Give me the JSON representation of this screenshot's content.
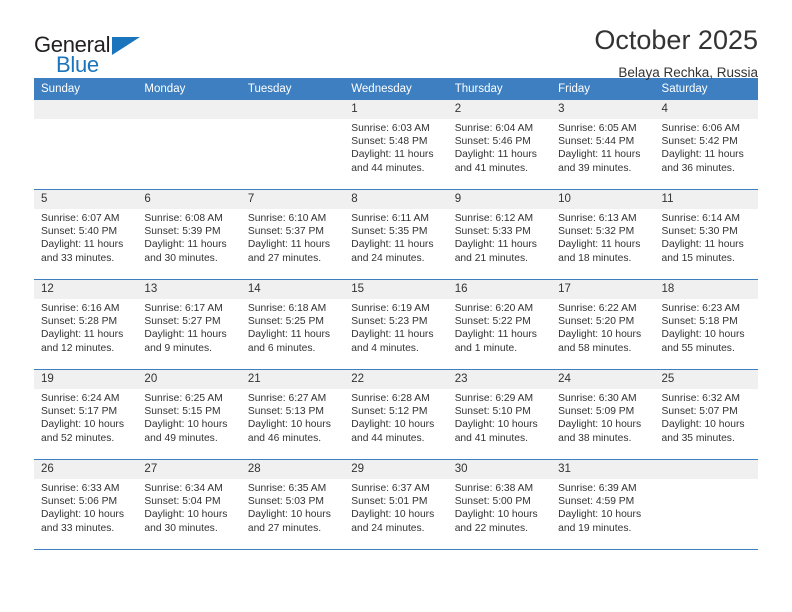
{
  "brand": {
    "name_line1": "General",
    "name_line2": "Blue",
    "accent_color": "#1b75bc"
  },
  "header": {
    "month_title": "October 2025",
    "location": "Belaya Rechka, Russia"
  },
  "calendar": {
    "header_color": "#3d7fc1",
    "weekday_headers": [
      "Sunday",
      "Monday",
      "Tuesday",
      "Wednesday",
      "Thursday",
      "Friday",
      "Saturday"
    ],
    "weeks": [
      [
        {
          "day": "",
          "lines": []
        },
        {
          "day": "",
          "lines": []
        },
        {
          "day": "",
          "lines": []
        },
        {
          "day": "1",
          "lines": [
            "Sunrise: 6:03 AM",
            "Sunset: 5:48 PM",
            "Daylight: 11 hours",
            "and 44 minutes."
          ]
        },
        {
          "day": "2",
          "lines": [
            "Sunrise: 6:04 AM",
            "Sunset: 5:46 PM",
            "Daylight: 11 hours",
            "and 41 minutes."
          ]
        },
        {
          "day": "3",
          "lines": [
            "Sunrise: 6:05 AM",
            "Sunset: 5:44 PM",
            "Daylight: 11 hours",
            "and 39 minutes."
          ]
        },
        {
          "day": "4",
          "lines": [
            "Sunrise: 6:06 AM",
            "Sunset: 5:42 PM",
            "Daylight: 11 hours",
            "and 36 minutes."
          ]
        }
      ],
      [
        {
          "day": "5",
          "lines": [
            "Sunrise: 6:07 AM",
            "Sunset: 5:40 PM",
            "Daylight: 11 hours",
            "and 33 minutes."
          ]
        },
        {
          "day": "6",
          "lines": [
            "Sunrise: 6:08 AM",
            "Sunset: 5:39 PM",
            "Daylight: 11 hours",
            "and 30 minutes."
          ]
        },
        {
          "day": "7",
          "lines": [
            "Sunrise: 6:10 AM",
            "Sunset: 5:37 PM",
            "Daylight: 11 hours",
            "and 27 minutes."
          ]
        },
        {
          "day": "8",
          "lines": [
            "Sunrise: 6:11 AM",
            "Sunset: 5:35 PM",
            "Daylight: 11 hours",
            "and 24 minutes."
          ]
        },
        {
          "day": "9",
          "lines": [
            "Sunrise: 6:12 AM",
            "Sunset: 5:33 PM",
            "Daylight: 11 hours",
            "and 21 minutes."
          ]
        },
        {
          "day": "10",
          "lines": [
            "Sunrise: 6:13 AM",
            "Sunset: 5:32 PM",
            "Daylight: 11 hours",
            "and 18 minutes."
          ]
        },
        {
          "day": "11",
          "lines": [
            "Sunrise: 6:14 AM",
            "Sunset: 5:30 PM",
            "Daylight: 11 hours",
            "and 15 minutes."
          ]
        }
      ],
      [
        {
          "day": "12",
          "lines": [
            "Sunrise: 6:16 AM",
            "Sunset: 5:28 PM",
            "Daylight: 11 hours",
            "and 12 minutes."
          ]
        },
        {
          "day": "13",
          "lines": [
            "Sunrise: 6:17 AM",
            "Sunset: 5:27 PM",
            "Daylight: 11 hours",
            "and 9 minutes."
          ]
        },
        {
          "day": "14",
          "lines": [
            "Sunrise: 6:18 AM",
            "Sunset: 5:25 PM",
            "Daylight: 11 hours",
            "and 6 minutes."
          ]
        },
        {
          "day": "15",
          "lines": [
            "Sunrise: 6:19 AM",
            "Sunset: 5:23 PM",
            "Daylight: 11 hours",
            "and 4 minutes."
          ]
        },
        {
          "day": "16",
          "lines": [
            "Sunrise: 6:20 AM",
            "Sunset: 5:22 PM",
            "Daylight: 11 hours",
            "and 1 minute."
          ]
        },
        {
          "day": "17",
          "lines": [
            "Sunrise: 6:22 AM",
            "Sunset: 5:20 PM",
            "Daylight: 10 hours",
            "and 58 minutes."
          ]
        },
        {
          "day": "18",
          "lines": [
            "Sunrise: 6:23 AM",
            "Sunset: 5:18 PM",
            "Daylight: 10 hours",
            "and 55 minutes."
          ]
        }
      ],
      [
        {
          "day": "19",
          "lines": [
            "Sunrise: 6:24 AM",
            "Sunset: 5:17 PM",
            "Daylight: 10 hours",
            "and 52 minutes."
          ]
        },
        {
          "day": "20",
          "lines": [
            "Sunrise: 6:25 AM",
            "Sunset: 5:15 PM",
            "Daylight: 10 hours",
            "and 49 minutes."
          ]
        },
        {
          "day": "21",
          "lines": [
            "Sunrise: 6:27 AM",
            "Sunset: 5:13 PM",
            "Daylight: 10 hours",
            "and 46 minutes."
          ]
        },
        {
          "day": "22",
          "lines": [
            "Sunrise: 6:28 AM",
            "Sunset: 5:12 PM",
            "Daylight: 10 hours",
            "and 44 minutes."
          ]
        },
        {
          "day": "23",
          "lines": [
            "Sunrise: 6:29 AM",
            "Sunset: 5:10 PM",
            "Daylight: 10 hours",
            "and 41 minutes."
          ]
        },
        {
          "day": "24",
          "lines": [
            "Sunrise: 6:30 AM",
            "Sunset: 5:09 PM",
            "Daylight: 10 hours",
            "and 38 minutes."
          ]
        },
        {
          "day": "25",
          "lines": [
            "Sunrise: 6:32 AM",
            "Sunset: 5:07 PM",
            "Daylight: 10 hours",
            "and 35 minutes."
          ]
        }
      ],
      [
        {
          "day": "26",
          "lines": [
            "Sunrise: 6:33 AM",
            "Sunset: 5:06 PM",
            "Daylight: 10 hours",
            "and 33 minutes."
          ]
        },
        {
          "day": "27",
          "lines": [
            "Sunrise: 6:34 AM",
            "Sunset: 5:04 PM",
            "Daylight: 10 hours",
            "and 30 minutes."
          ]
        },
        {
          "day": "28",
          "lines": [
            "Sunrise: 6:35 AM",
            "Sunset: 5:03 PM",
            "Daylight: 10 hours",
            "and 27 minutes."
          ]
        },
        {
          "day": "29",
          "lines": [
            "Sunrise: 6:37 AM",
            "Sunset: 5:01 PM",
            "Daylight: 10 hours",
            "and 24 minutes."
          ]
        },
        {
          "day": "30",
          "lines": [
            "Sunrise: 6:38 AM",
            "Sunset: 5:00 PM",
            "Daylight: 10 hours",
            "and 22 minutes."
          ]
        },
        {
          "day": "31",
          "lines": [
            "Sunrise: 6:39 AM",
            "Sunset: 4:59 PM",
            "Daylight: 10 hours",
            "and 19 minutes."
          ]
        },
        {
          "day": "",
          "lines": []
        }
      ]
    ]
  }
}
